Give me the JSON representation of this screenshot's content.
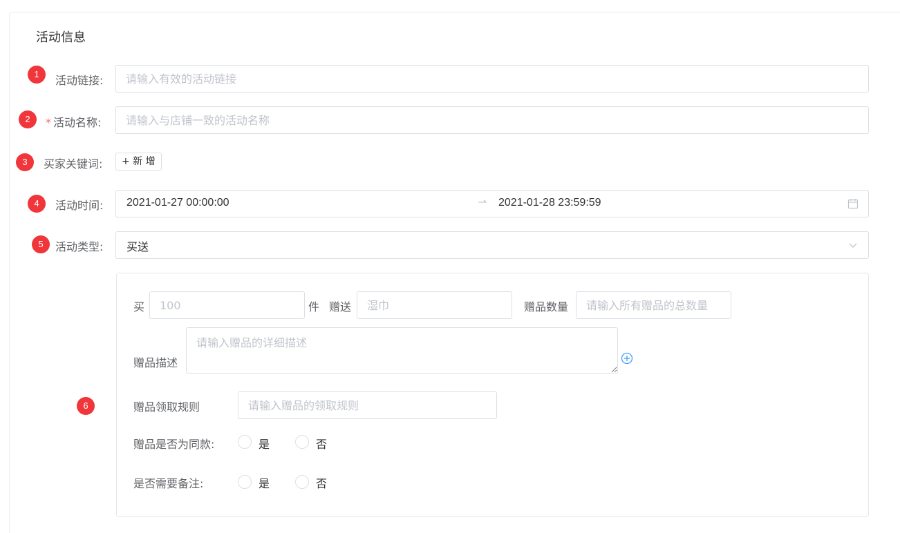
{
  "section": {
    "title": "活动信息"
  },
  "badges": [
    "1",
    "2",
    "3",
    "4",
    "5",
    "6"
  ],
  "fields": {
    "link": {
      "label": "活动链接:",
      "placeholder": "请输入有效的活动链接"
    },
    "name": {
      "required_mark": "*",
      "label": "活动名称:",
      "placeholder": "请输入与店铺一致的活动名称"
    },
    "keywords": {
      "label": "买家关键词:",
      "add_button": "+ 新 增"
    },
    "time": {
      "label": "活动时间:",
      "start": "2021-01-27 00:00:00",
      "separator": "⇀",
      "end": "2021-01-28 23:59:59"
    },
    "type": {
      "label": "活动类型:",
      "value": "买送"
    }
  },
  "gift": {
    "buy_label": "买",
    "buy_placeholder": "100",
    "unit_label": "件",
    "give_label": "赠送",
    "give_placeholder": "湿巾",
    "qty_label": "赠品数量",
    "qty_placeholder": "请输入所有赠品的总数量",
    "desc_label": "赠品描述",
    "desc_placeholder": "请输入赠品的详细描述",
    "rule_label": "赠品领取规则",
    "rule_placeholder": "请输入赠品的领取规则",
    "same_label": "赠品是否为同款:",
    "remark_label": "是否需要备注:",
    "yes": "是",
    "no": "否"
  },
  "colors": {
    "badge": "#f0363a",
    "border": "#dcdfe6",
    "placeholder": "#c0c4cc",
    "accent": "#409eff"
  }
}
